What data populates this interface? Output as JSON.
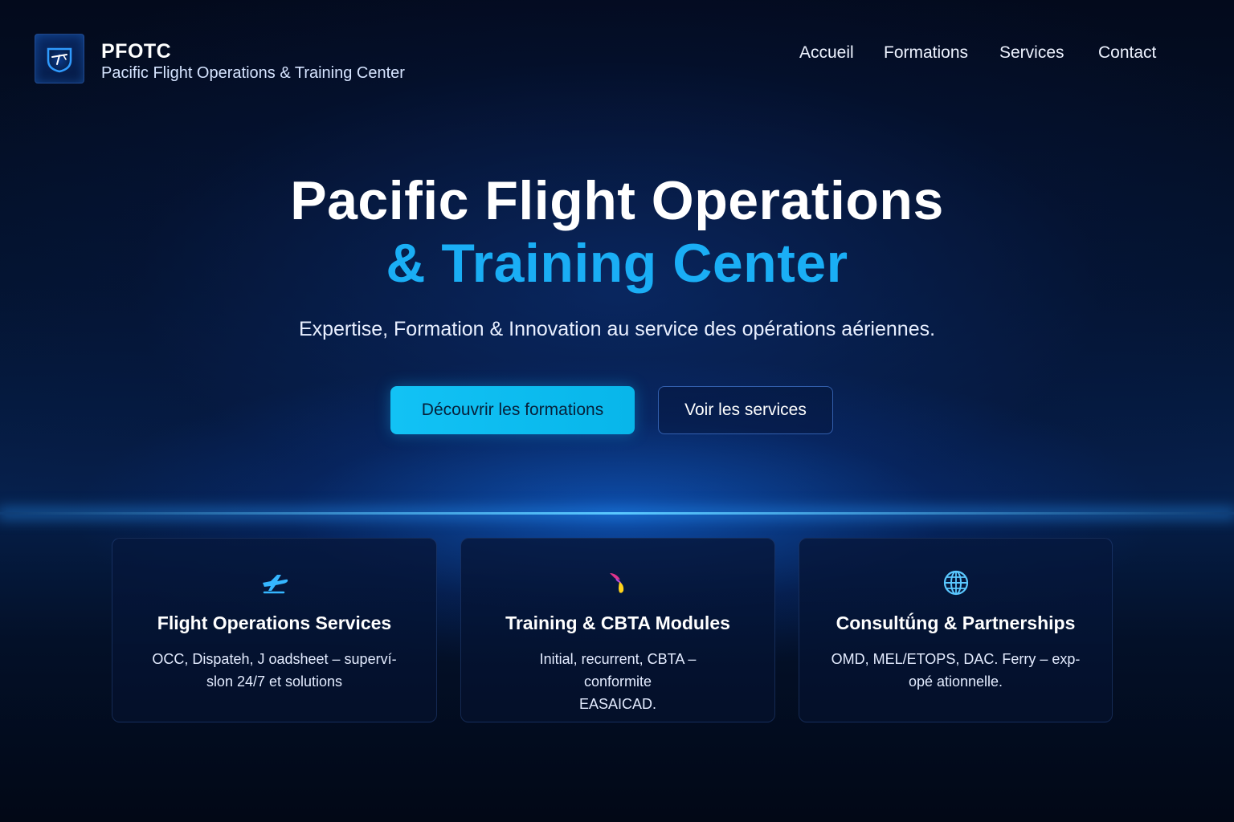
{
  "header": {
    "brand_name": "PFOTC",
    "brand_subtitle": "Pacific Flight Operations & Training Center",
    "logo_icon": "compass-plane-icon",
    "nav": [
      {
        "label": "Accueil"
      },
      {
        "label": "Formations"
      },
      {
        "label": "Services"
      },
      {
        "label": "Contact"
      }
    ]
  },
  "hero": {
    "title_line1": "Pacific Flight Operations",
    "title_line2": "& Training Center",
    "description": "Expertise, Formation & Innovation au service des opérations aériennes.",
    "primary_button": "Découvrir les formations",
    "secondary_button": "Voir les services"
  },
  "cards": [
    {
      "icon": "airplane-icon",
      "title": "Flight Operations Services",
      "lines": [
        "OCC, Dispateh, J oadsheet – superví-",
        "slon 24/7 et solutions"
      ]
    },
    {
      "icon": "feather-icon",
      "title": "Training & CBTA Modules",
      "lines": [
        "Initial, recurrent, CBTA –",
        "conformite",
        "EASAICAD."
      ]
    },
    {
      "icon": "globe-icon",
      "title": "Consultǘng & Partnerships",
      "lines": [
        "OMD, MEL/ETOPS, DAC. Ferry – exp-",
        "opé ationnelle."
      ]
    }
  ],
  "colors": {
    "background_top": "#030a1c",
    "background_mid": "#06204c",
    "accent": "#1aaef5",
    "primary_button": "#12c2f5",
    "glow_line": "#5ac8ff"
  }
}
